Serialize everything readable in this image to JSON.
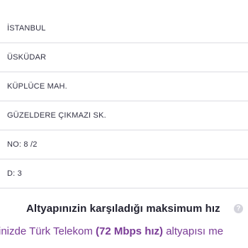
{
  "address_fields": [
    {
      "value": "İSTANBUL"
    },
    {
      "value": "ÜSKÜDAR"
    },
    {
      "value": "KÜPLÜCE MAH."
    },
    {
      "value": "GÜZELDERE ÇIKMAZI SK."
    },
    {
      "value": "NO: 8 /2"
    },
    {
      "value": "D: 3"
    }
  ],
  "speed_section": {
    "heading": "Altyapınızin karşıladığı maksimum hız",
    "help_icon": "question-icon",
    "help_glyph": "?",
    "info_prefix": "inizde Türk Telekom ",
    "info_speed": "(72 Mbps hız)",
    "info_suffix": " altyapısı me"
  },
  "colors": {
    "accent": "#7a3b96",
    "divider": "#dcdce2",
    "help_icon_bg": "#d4d4dc"
  }
}
